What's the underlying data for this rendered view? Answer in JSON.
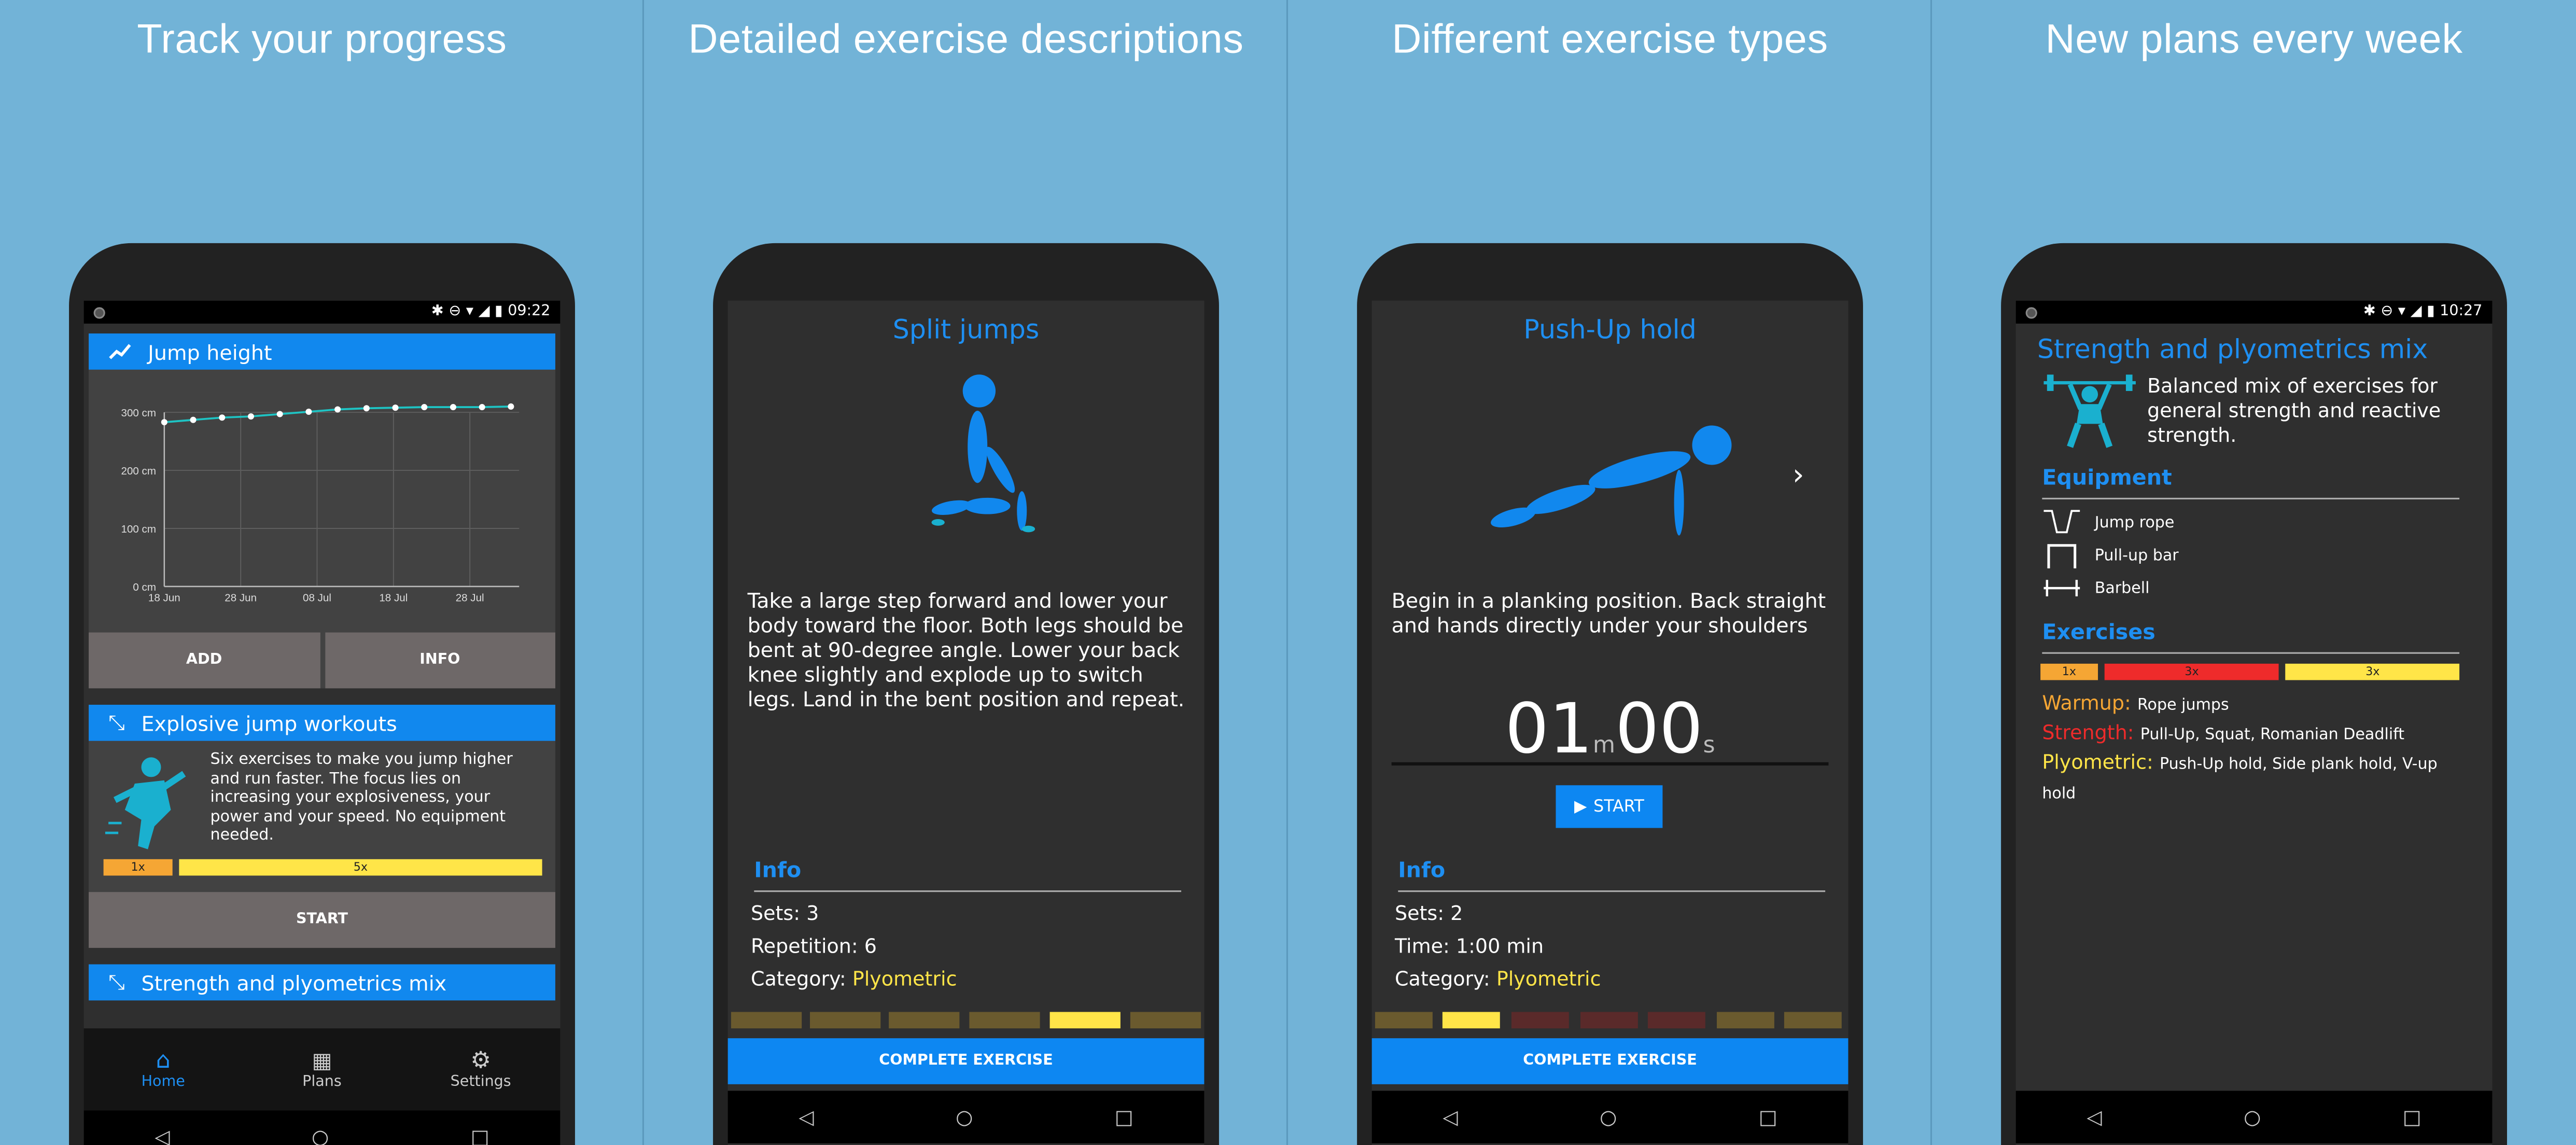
{
  "panels": [
    {
      "title": "Track your progress"
    },
    {
      "title": "Detailed exercise descriptions"
    },
    {
      "title": "Different exercise types"
    },
    {
      "title": "New plans every week"
    }
  ],
  "p1": {
    "time": "09:22",
    "chart_card": {
      "title": "Jump height"
    },
    "chart_data": {
      "type": "line",
      "title": "Jump height",
      "yticks": [
        "300 cm",
        "200 cm",
        "100 cm",
        "0 cm"
      ],
      "xticks": [
        "18 Jun",
        "28 Jun",
        "08 Jul",
        "18 Jul",
        "28 Jul"
      ],
      "ylim": [
        0,
        300
      ],
      "x": [
        "18 Jun",
        "22 Jun",
        "26 Jun",
        "29 Jun",
        "03 Jul",
        "09 Jul",
        "13 Jul",
        "16 Jul",
        "20 Jul",
        "25 Jul",
        "30 Jul",
        "03 Aug",
        "07 Aug"
      ],
      "values": [
        283,
        287,
        291,
        293,
        297,
        301,
        305,
        307,
        308,
        309,
        309,
        309,
        310
      ],
      "grid": true
    },
    "buttons": {
      "add": "ADD",
      "info": "INFO",
      "start": "START"
    },
    "workout": {
      "title": "Explosive jump workouts",
      "desc": "Six exercises to make you jump higher and run faster. The focus lies on increasing your explosiveness, your power and your speed. No equipment needed.",
      "bar1": "1x",
      "bar2": "5x"
    },
    "next_card": {
      "title": "Strength and plyometrics mix"
    },
    "nav": [
      {
        "label": "Home"
      },
      {
        "label": "Plans"
      },
      {
        "label": "Settings"
      }
    ]
  },
  "p2": {
    "title": "Split jumps",
    "desc": "Take a large step forward and lower your body toward the floor. Both legs should be bent at 90-degree angle. Lower your back knee slightly and explode up to switch legs. Land in the bent position and repeat.",
    "info": "Info",
    "sets": "Sets: 3",
    "reps": "Repetition: 6",
    "cat_label": "Category:",
    "cat": "Plyometric",
    "complete": "COMPLETE EXERCISE"
  },
  "p3": {
    "title": "Push-Up hold",
    "desc": "Begin in a planking position. Back straight and hands directly under your shoulders",
    "min": "01",
    "m": "m",
    "sec": "00",
    "s": "s",
    "start": "START",
    "info": "Info",
    "sets": "Sets: 2",
    "time": "Time: 1:00 min",
    "cat_label": "Category:",
    "cat": "Plyometric",
    "complete": "COMPLETE EXERCISE"
  },
  "p4": {
    "time": "10:27",
    "title": "Strength and plyometrics mix",
    "desc": "Balanced mix of exercises for general strength and reactive strength.",
    "equipment": "Equipment",
    "items": [
      "Jump rope",
      "Pull-up bar",
      "Barbell"
    ],
    "exercises": "Exercises",
    "bars": [
      "1x",
      "3x",
      "3x"
    ],
    "warmup_label": "Warmup:",
    "warmup": "Rope jumps",
    "strength_label": "Strength:",
    "strength": "Pull-Up, Squat, Romanian Deadlift",
    "plyo_label": "Plyometric:",
    "plyo": "Push-Up hold, Side plank hold, V-up hold"
  },
  "colors": {
    "accent": "#1188ee",
    "yellow": "#ffe548",
    "red": "#ee2b2b",
    "orange": "#f5a634",
    "bg": "#72b3d7"
  }
}
